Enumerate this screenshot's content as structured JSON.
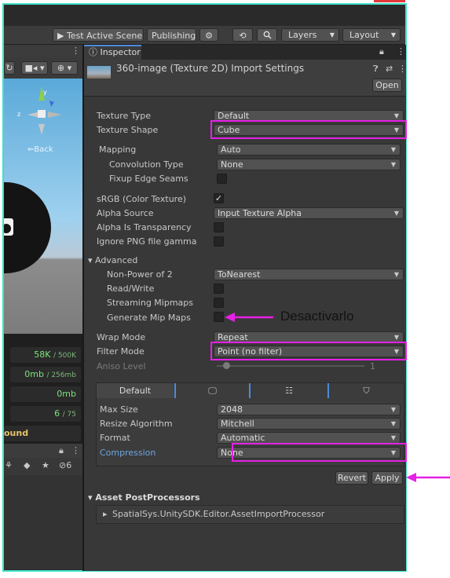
{
  "toolbar": {
    "test_scene": "▶ Test Active Scene",
    "publishing": "Publishing",
    "layers": "Layers",
    "layout": "Layout"
  },
  "scene": {
    "back_label": "Back",
    "stats": [
      {
        "main": "58K",
        "sub": "/ 500K"
      },
      {
        "main": "0mb",
        "sub": "/ 256mb"
      },
      {
        "main": "0mb",
        "sub": ""
      },
      {
        "main": "6",
        "sub": "/ 75"
      }
    ],
    "status_label": "ound",
    "hidden_count": "6"
  },
  "inspector": {
    "tab": "Inspector",
    "asset_title": "360-image (Texture 2D) Import Settings",
    "open_button": "Open",
    "texture_type_label": "Texture Type",
    "texture_type_value": "Default",
    "texture_shape_label": "Texture Shape",
    "texture_shape_value": "Cube",
    "mapping_label": "Mapping",
    "mapping_value": "Auto",
    "convolution_label": "Convolution Type",
    "convolution_value": "None",
    "fixup_label": "Fixup Edge Seams",
    "srgb_label": "sRGB (Color Texture)",
    "alpha_source_label": "Alpha Source",
    "alpha_source_value": "Input Texture Alpha",
    "alpha_transp_label": "Alpha Is Transparency",
    "ignore_png_label": "Ignore PNG file gamma",
    "advanced_label": "Advanced",
    "npot_label": "Non-Power of 2",
    "npot_value": "ToNearest",
    "readwrite_label": "Read/Write",
    "streaming_label": "Streaming Mipmaps",
    "genmip_label": "Generate Mip Maps",
    "wrap_label": "Wrap Mode",
    "wrap_value": "Repeat",
    "filter_label": "Filter Mode",
    "filter_value": "Point (no filter)",
    "aniso_label": "Aniso Level",
    "aniso_value": "1",
    "platform_default": "Default",
    "maxsize_label": "Max Size",
    "maxsize_value": "2048",
    "resize_label": "Resize Algorithm",
    "resize_value": "Mitchell",
    "format_label": "Format",
    "format_value": "Automatic",
    "compression_label": "Compression",
    "compression_value": "None",
    "revert_button": "Revert",
    "apply_button": "Apply",
    "postproc_label": "Asset PostProcessors",
    "postproc_item": "SpatialSys.UnitySDK.Editor.AssetImportProcessor"
  },
  "annotation": {
    "text": "Desactivarlo",
    "color": "#e620e6"
  }
}
